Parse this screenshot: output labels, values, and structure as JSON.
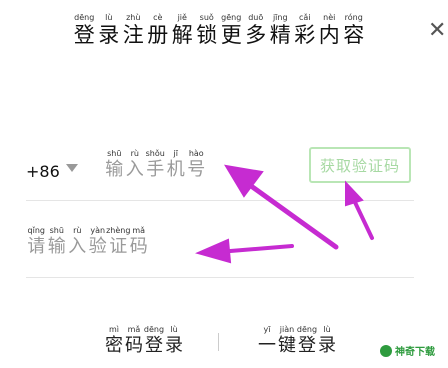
{
  "header": {
    "title_chars": [
      {
        "py": "dēng",
        "hz": "登"
      },
      {
        "py": "lù",
        "hz": "录"
      },
      {
        "py": "zhù",
        "hz": "注"
      },
      {
        "py": "cè",
        "hz": "册"
      },
      {
        "py": "jiě",
        "hz": "解"
      },
      {
        "py": "suǒ",
        "hz": "锁"
      },
      {
        "py": "gēng",
        "hz": "更"
      },
      {
        "py": "duō",
        "hz": "多"
      },
      {
        "py": "jīng",
        "hz": "精"
      },
      {
        "py": "cǎi",
        "hz": "彩"
      },
      {
        "py": "nèi",
        "hz": "内"
      },
      {
        "py": "róng",
        "hz": "容"
      }
    ],
    "close_symbol": "✕"
  },
  "phone": {
    "country_code": "+86",
    "placeholder_chars": [
      {
        "py": "shū",
        "hz": "输"
      },
      {
        "py": "rù",
        "hz": "入"
      },
      {
        "py": "shǒu",
        "hz": "手"
      },
      {
        "py": "jī",
        "hz": "机"
      },
      {
        "py": "hào",
        "hz": "号"
      }
    ],
    "get_code_label": "获取验证码"
  },
  "code": {
    "placeholder_chars": [
      {
        "py": "qǐng",
        "hz": "请"
      },
      {
        "py": "shū",
        "hz": "输"
      },
      {
        "py": "rù",
        "hz": "入"
      },
      {
        "py": "yàn",
        "hz": "验"
      },
      {
        "py": "zhèng",
        "hz": "证"
      },
      {
        "py": "mǎ",
        "hz": "码"
      }
    ]
  },
  "footer": {
    "password_login_chars": [
      {
        "py": "mì",
        "hz": "密"
      },
      {
        "py": "mǎ",
        "hz": "码"
      },
      {
        "py": "dēng",
        "hz": "登"
      },
      {
        "py": "lù",
        "hz": "录"
      }
    ],
    "onekey_login_chars": [
      {
        "py": "yī",
        "hz": "一"
      },
      {
        "py": "jiàn",
        "hz": "键"
      },
      {
        "py": "dēng",
        "hz": "登"
      },
      {
        "py": "lù",
        "hz": "录"
      }
    ]
  },
  "watermark": {
    "text": "神奇下载"
  },
  "colors": {
    "annotation_arrow": "#c62bd1",
    "get_code_border": "#b9e6b5",
    "get_code_text": "#a7d9a3",
    "placeholder": "#9a9a9a"
  }
}
